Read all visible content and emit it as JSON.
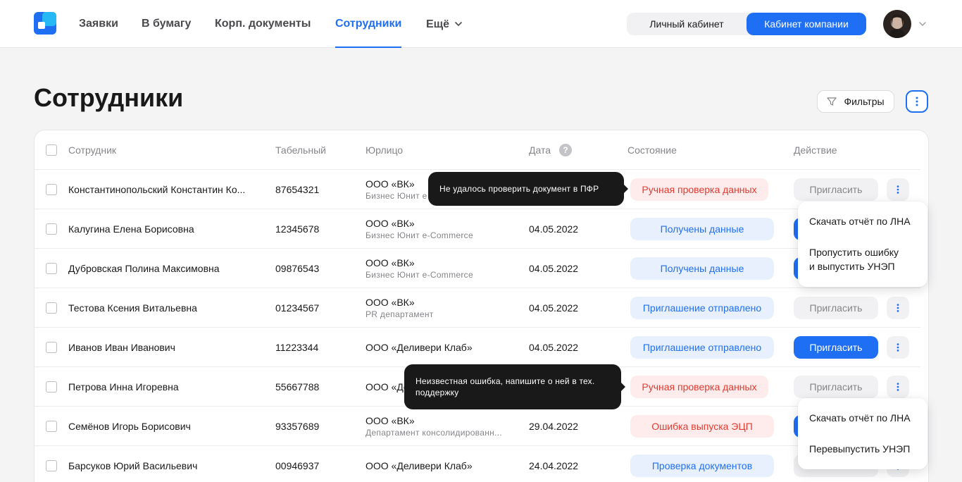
{
  "nav": {
    "items": [
      "Заявки",
      "В бумагу",
      "Корп. документы",
      "Сотрудники"
    ],
    "more_label": "Ещё",
    "active": "Сотрудники"
  },
  "cabinets": {
    "personal": "Личный кабинет",
    "company": "Кабинет компании",
    "active": "company"
  },
  "page": {
    "title": "Сотрудники",
    "filters_label": "Фильтры"
  },
  "table": {
    "headers": {
      "employee": "Сотрудник",
      "tab_number": "Табельный",
      "org": "Юрлицо",
      "date": "Дата",
      "state": "Состояние",
      "action": "Действие"
    },
    "rows": [
      {
        "name": "Константинопольский Константин Ко...",
        "tab": "87654321",
        "org": "ООО «ВК»",
        "org_sub": "Бизнес Юнит e",
        "date": "",
        "state": "Ручная проверка данных",
        "state_type": "red",
        "action": "Пригласить",
        "action_type": "disabled"
      },
      {
        "name": "Калугина Елена Борисовна",
        "tab": "12345678",
        "org": "ООО «ВК»",
        "org_sub": "Бизнес Юнит e-Commerce",
        "date": "04.05.2022",
        "state": "Получены данные",
        "state_type": "blue",
        "action": "",
        "action_type": "primary"
      },
      {
        "name": "Дубровская Полина Максимовна",
        "tab": "09876543",
        "org": "ООО «ВК»",
        "org_sub": "Бизнес Юнит e-Commerce",
        "date": "04.05.2022",
        "state": "Получены данные",
        "state_type": "blue",
        "action": "",
        "action_type": "primary"
      },
      {
        "name": "Тестова Ксения Витальевна",
        "tab": "01234567",
        "org": "ООО «ВК»",
        "org_sub": "PR департамент",
        "date": "04.05.2022",
        "state": "Приглашение отправлено",
        "state_type": "blue",
        "action": "Пригласить",
        "action_type": "disabled"
      },
      {
        "name": "Иванов Иван Иванович",
        "tab": "11223344",
        "org": "ООО «Деливери Клаб»",
        "org_sub": "",
        "date": "04.05.2022",
        "state": "Приглашение отправлено",
        "state_type": "blue",
        "action": "Пригласить",
        "action_type": "primary"
      },
      {
        "name": "Петрова Инна Игоревна",
        "tab": "55667788",
        "org": "ООО «Де",
        "org_sub": "",
        "date": "",
        "state": "Ручная проверка данных",
        "state_type": "red",
        "action": "Пригласить",
        "action_type": "disabled"
      },
      {
        "name": "Семёнов Игорь Борисович",
        "tab": "93357689",
        "org": "ООО «ВК»",
        "org_sub": "Департамент консолидированн...",
        "date": "29.04.2022",
        "state": "Ошибка выпуска ЭЦП",
        "state_type": "red",
        "action": "",
        "action_type": "primary"
      },
      {
        "name": "Барсуков Юрий Васильевич",
        "tab": "00946937",
        "org": "ООО «Деливери Клаб»",
        "org_sub": "",
        "date": "24.04.2022",
        "state": "Проверка документов",
        "state_type": "blue",
        "action": "",
        "action_type": "disabled"
      }
    ]
  },
  "tooltips": {
    "pfr_error": "Не удалось проверить документ в ПФР",
    "unknown_error": "Неизвестная ошибка, напишите о ней в тех. поддержку"
  },
  "menus": {
    "menu1": [
      "Скачать отчёт по ЛНА",
      "Пропустить ошибку и выпустить УНЭП"
    ],
    "menu2": [
      "Скачать отчёт по ЛНА",
      "Перевыпустить УНЭП"
    ]
  },
  "colors": {
    "accent": "#1f6ff5",
    "error": "#e23b31",
    "error_bg": "#fdeceb",
    "info_bg": "#e8f0fe"
  },
  "icons": [
    "logo-icon",
    "chevron-down-icon",
    "filter-icon",
    "more-vertical-icon",
    "help-icon",
    "avatar"
  ]
}
